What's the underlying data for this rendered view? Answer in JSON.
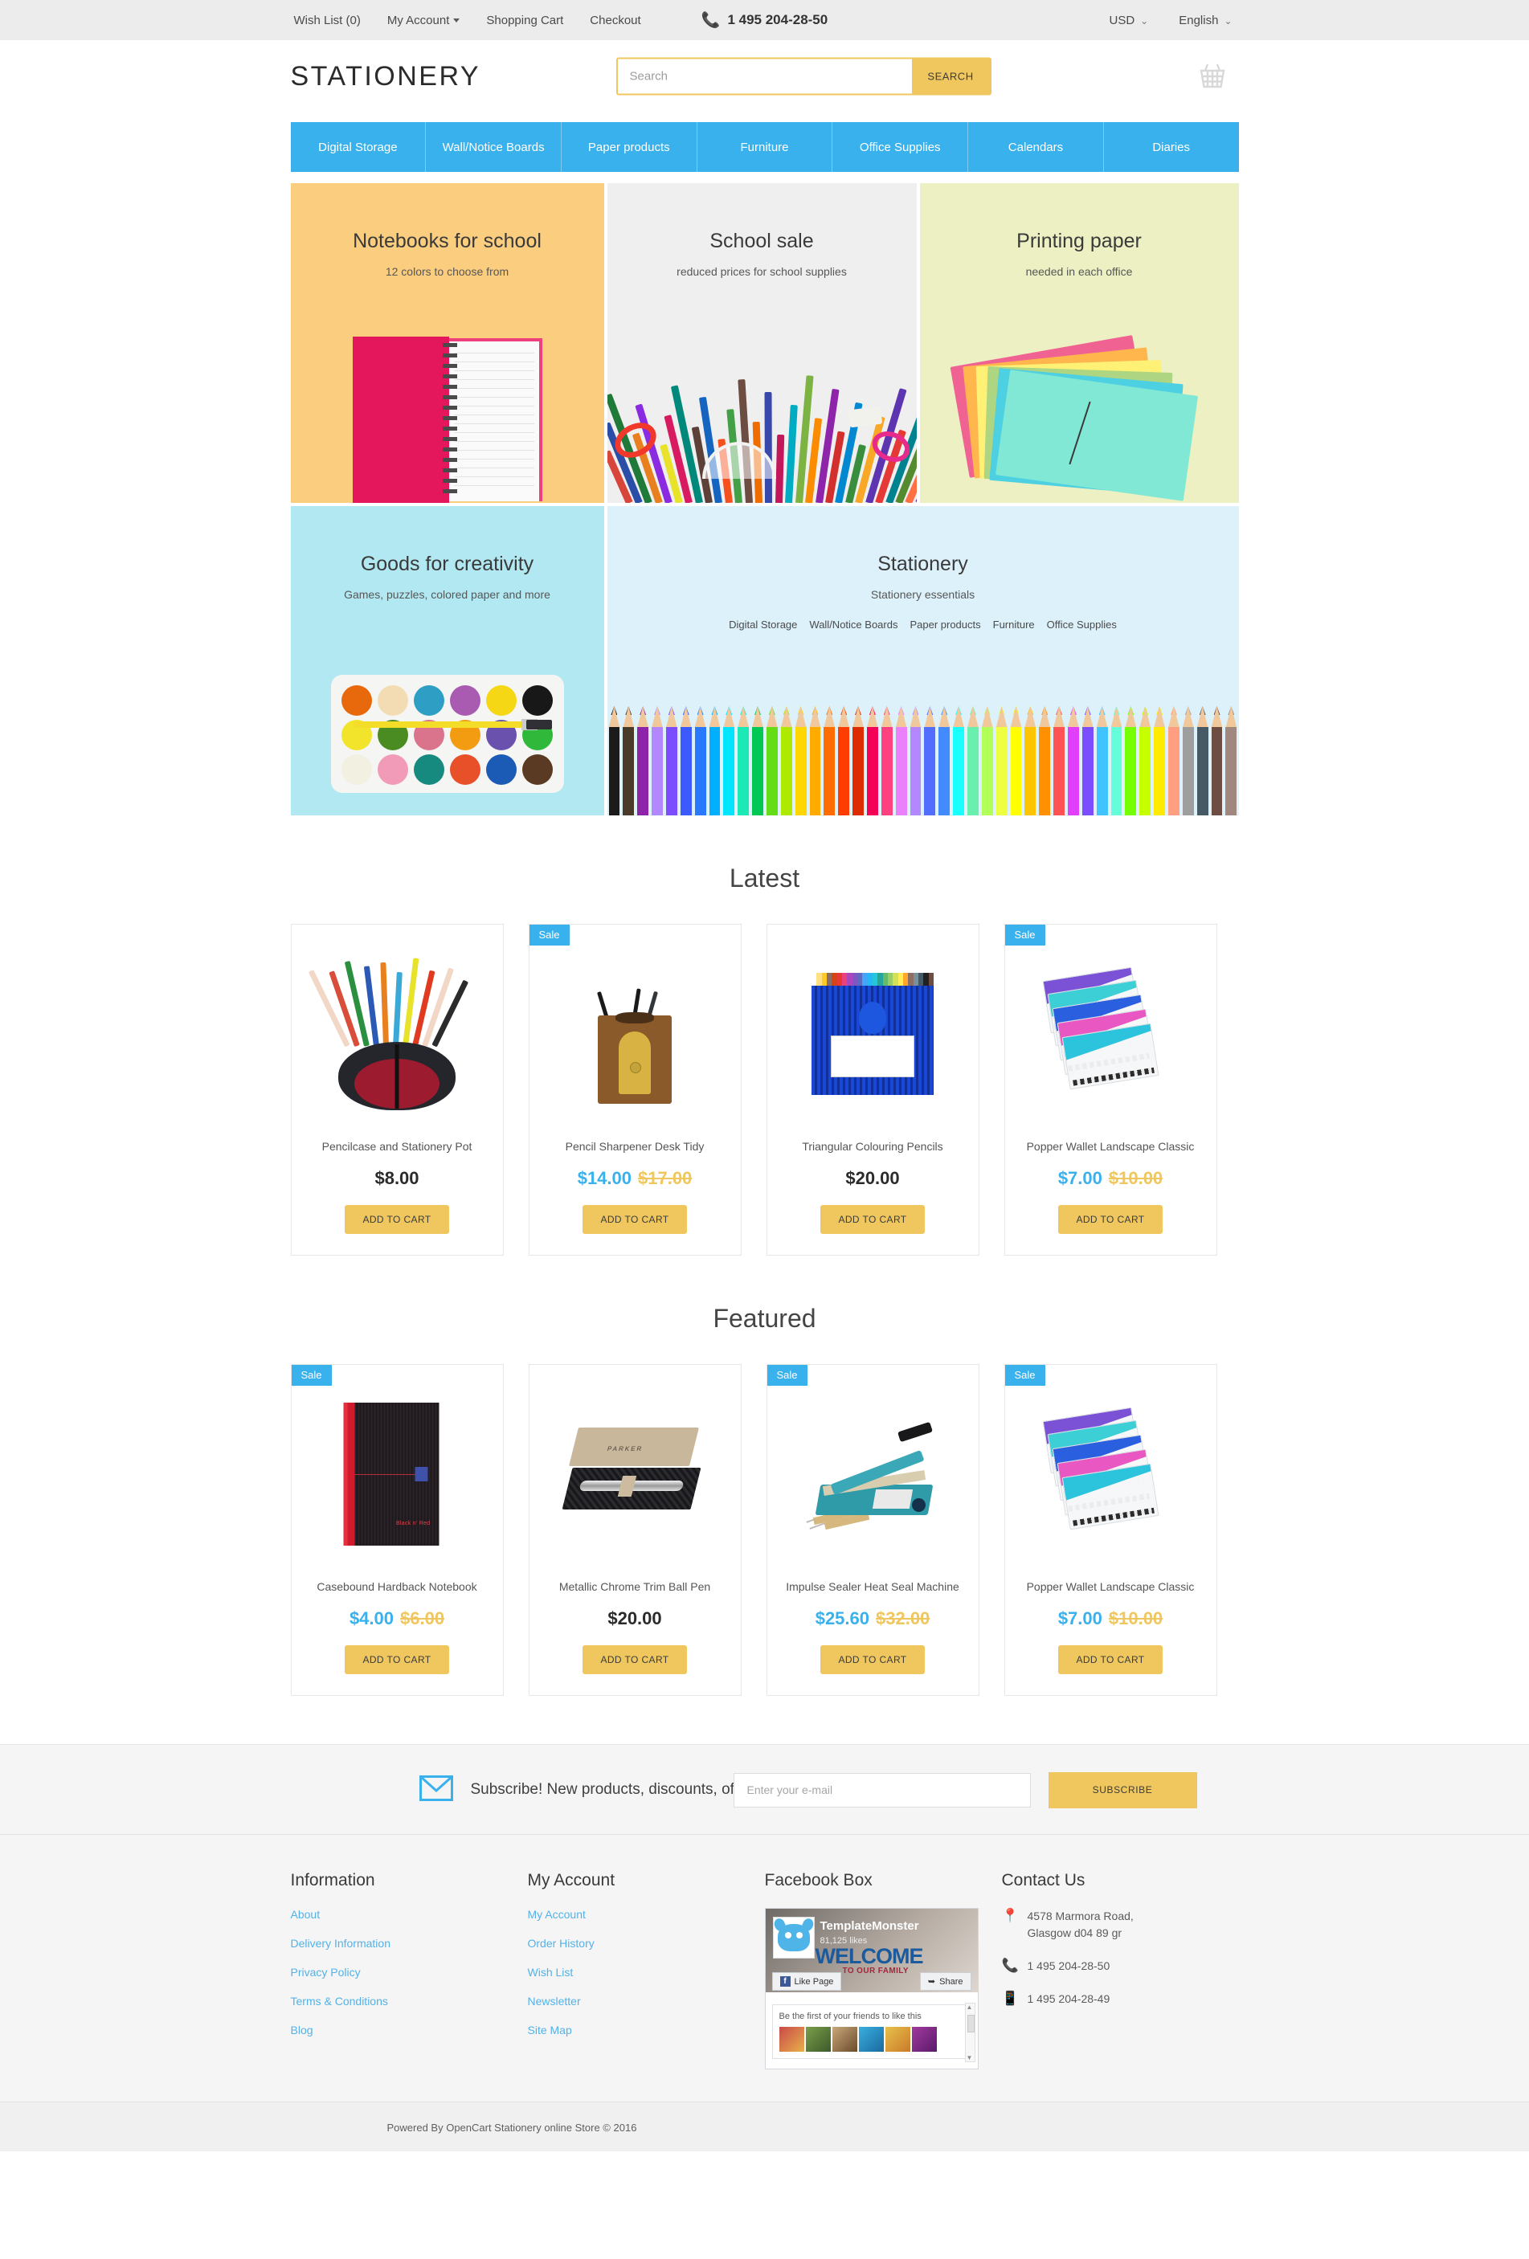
{
  "topbar": {
    "links": [
      {
        "label": "Wish List (0)",
        "caret": false
      },
      {
        "label": "My Account",
        "caret": true
      },
      {
        "label": "Shopping Cart",
        "caret": false
      },
      {
        "label": "Checkout",
        "caret": false
      }
    ],
    "phone": "1 495 204-28-50",
    "currency": "USD",
    "language": "English",
    "phone_icon": "phone-icon"
  },
  "header": {
    "logo": "STATIONERY",
    "search_placeholder": "Search",
    "search_value": "",
    "search_button": "SEARCH",
    "cart_icon": "shopping-basket-icon"
  },
  "nav": {
    "items": [
      "Digital Storage",
      "Wall/Notice Boards",
      "Paper products",
      "Furniture",
      "Office Supplies",
      "Calendars",
      "Diaries"
    ]
  },
  "banners": {
    "notebooks": {
      "title": "Notebooks for school",
      "sub": "12 colors to choose from",
      "bg": "#fbcd7f"
    },
    "school_sale": {
      "title": "School sale",
      "sub": "reduced prices for school supplies",
      "bg": "#efefef"
    },
    "printing": {
      "title": "Printing paper",
      "sub": "needed in each office",
      "bg": "#ecf0c2"
    },
    "creativity": {
      "title": "Goods for creativity",
      "sub": "Games, puzzles, colored paper and more",
      "bg": "#b2e8f1"
    },
    "stationery": {
      "title": "Stationery",
      "sub": "Stationery essentials",
      "bg": "#ddf1fb",
      "links": [
        "Digital Storage",
        "Wall/Notice Boards",
        "Paper products",
        "Furniture",
        "Office Supplies"
      ]
    }
  },
  "sections": {
    "latest_title": "Latest",
    "featured_title": "Featured",
    "add_to_cart": "ADD TO CART",
    "sale_badge": "Sale"
  },
  "latest_products": [
    {
      "name": "Pencilcase and Stationery Pot",
      "price": "$8.00",
      "old_price": "",
      "sale": false,
      "art": "pencilcase"
    },
    {
      "name": "Pencil Sharpener Desk Tidy",
      "price": "$14.00",
      "old_price": "$17.00",
      "sale": true,
      "art": "sharpener"
    },
    {
      "name": "Triangular Colouring Pencils",
      "price": "$20.00",
      "old_price": "",
      "sale": false,
      "art": "pencil-tin"
    },
    {
      "name": "Popper Wallet Landscape Classic",
      "price": "$7.00",
      "old_price": "$10.00",
      "sale": true,
      "art": "wallets"
    }
  ],
  "featured_products": [
    {
      "name": "Casebound Hardback Notebook",
      "price": "$4.00",
      "old_price": "$6.00",
      "sale": true,
      "art": "notebook"
    },
    {
      "name": "Metallic Chrome Trim Ball Pen",
      "price": "$20.00",
      "old_price": "",
      "sale": false,
      "art": "penbox"
    },
    {
      "name": "Impulse Sealer Heat Seal Machine",
      "price": "$25.60",
      "old_price": "$32.00",
      "sale": true,
      "art": "sealer"
    },
    {
      "name": "Popper Wallet Landscape Classic",
      "price": "$7.00",
      "old_price": "$10.00",
      "sale": true,
      "art": "wallets"
    }
  ],
  "newsletter": {
    "text": "Subscribe! New products, discounts, offers!",
    "placeholder": "Enter your e-mail",
    "value": "",
    "button": "SUBSCRIBE",
    "icon": "envelope-icon"
  },
  "footer": {
    "information": {
      "title": "Information",
      "links": [
        "About",
        "Delivery Information",
        "Privacy Policy",
        "Terms & Conditions",
        "Blog"
      ]
    },
    "my_account": {
      "title": "My Account",
      "links": [
        "My Account",
        "Order History",
        "Wish List",
        "Newsletter",
        "Site Map"
      ]
    },
    "facebook": {
      "title": "Facebook Box",
      "page_name": "TemplateMonster",
      "likes": "81,125 likes",
      "cover_text": "WELCOME",
      "cover_subtext": "TO OUR FAMILY",
      "like_button": "Like Page",
      "share_button": "Share",
      "card_text": "Be the first of your friends to like this"
    },
    "contact": {
      "title": "Contact Us",
      "address": "4578 Marmora Road,\nGlasgow d04 89 gr",
      "phone": "1 495 204-28-50",
      "mobile": "1 495 204-28-49",
      "address_icon": "location-pin-icon",
      "phone_icon": "phone-icon",
      "mobile_icon": "mobile-phone-icon"
    }
  },
  "copyright": "Powered By OpenCart Stationery online Store © 2016",
  "colors": {
    "accent_blue": "#39b1ec",
    "accent_yellow": "#efc75e",
    "link_blue": "#52b2e8",
    "topbar_bg": "#ececec",
    "footer_bg": "#f5f5f5"
  }
}
